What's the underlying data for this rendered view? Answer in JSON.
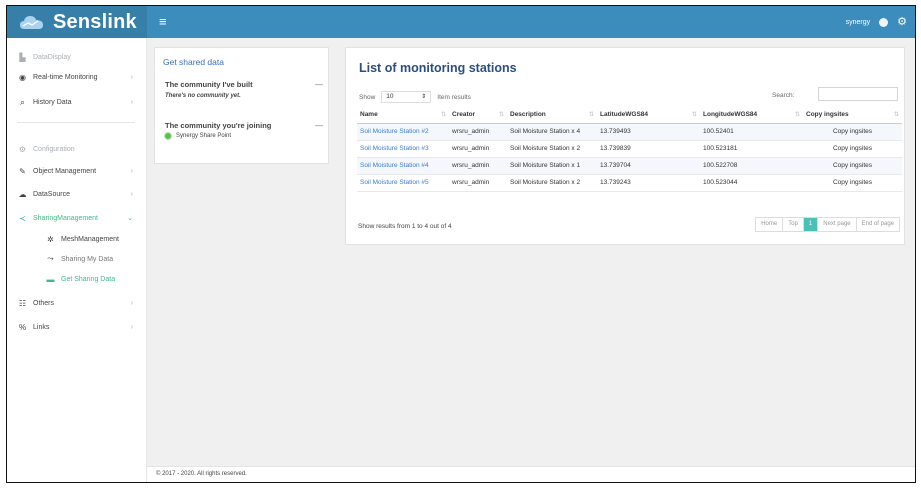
{
  "header": {
    "logo_text": "Senslink",
    "user": "synergy",
    "menu_icon": "hamburger-icon",
    "user_icon": "avatar-icon",
    "settings_icon": "gear-icon",
    "brand_color": "#3c8dbc"
  },
  "sidebar": {
    "items": [
      {
        "label": "DataDisplay",
        "icon": "bar-chart-icon"
      },
      {
        "label": "Real-time Monitoring",
        "icon": "eye-icon"
      },
      {
        "label": "History Data",
        "icon": "search-icon"
      },
      {
        "label": "Configuration",
        "icon": "settings-icon"
      },
      {
        "label": "Object Management",
        "icon": "wrench-icon"
      },
      {
        "label": "DataSource",
        "icon": "cloud-icon"
      },
      {
        "label": "SharingManagement",
        "icon": "share-icon"
      },
      {
        "label": "MeshManagement",
        "icon": "network-icon"
      },
      {
        "label": "Sharing My Data",
        "icon": "share-out-icon"
      },
      {
        "label": "Get Sharing Data",
        "icon": "download-icon"
      },
      {
        "label": "Others",
        "icon": "others-icon"
      },
      {
        "label": "Links",
        "icon": "link-icon"
      }
    ],
    "chevron": "›"
  },
  "shared": {
    "title": "Get shared data",
    "built_title": "The community I've built",
    "built_empty": "There's no community yet.",
    "joining_title": "The community you're joining",
    "joining_item": "Synergy Share Point",
    "collapse": "—"
  },
  "stations": {
    "title": "List of monitoring stations",
    "show_label": "Show",
    "page_size": "10",
    "results_label": "Item results",
    "search_label": "Search:",
    "search_value": "",
    "columns": [
      "Name",
      "Creator",
      "Description",
      "LatitudeWGS84",
      "LongitudeWGS84",
      "Copy ingsites"
    ],
    "rows": [
      [
        "Soil Moisture Station #2",
        "wrsru_admin",
        "Soil Moisture Station x 4",
        "13.739493",
        "100.52401",
        "Copy ingsites"
      ],
      [
        "Soil Moisture Station #3",
        "wrsru_admin",
        "Soil Moisture Station x 2",
        "13.739839",
        "100.523181",
        "Copy ingsites"
      ],
      [
        "Soil Moisture Station #4",
        "wrsru_admin",
        "Soil Moisture Station x 1",
        "13.739704",
        "100.522708",
        "Copy ingsites"
      ],
      [
        "Soil Moisture Station #5",
        "wrsru_admin",
        "Soil Moisture Station x 2",
        "13.739243",
        "100.523044",
        "Copy ingsites"
      ]
    ],
    "info": "Show results from 1 to 4 out of 4",
    "pager": [
      "Home",
      "Top",
      "1",
      "Next page",
      "End of page"
    ]
  },
  "footer": {
    "text": "© 2017 - 2020. All rights reserved."
  }
}
